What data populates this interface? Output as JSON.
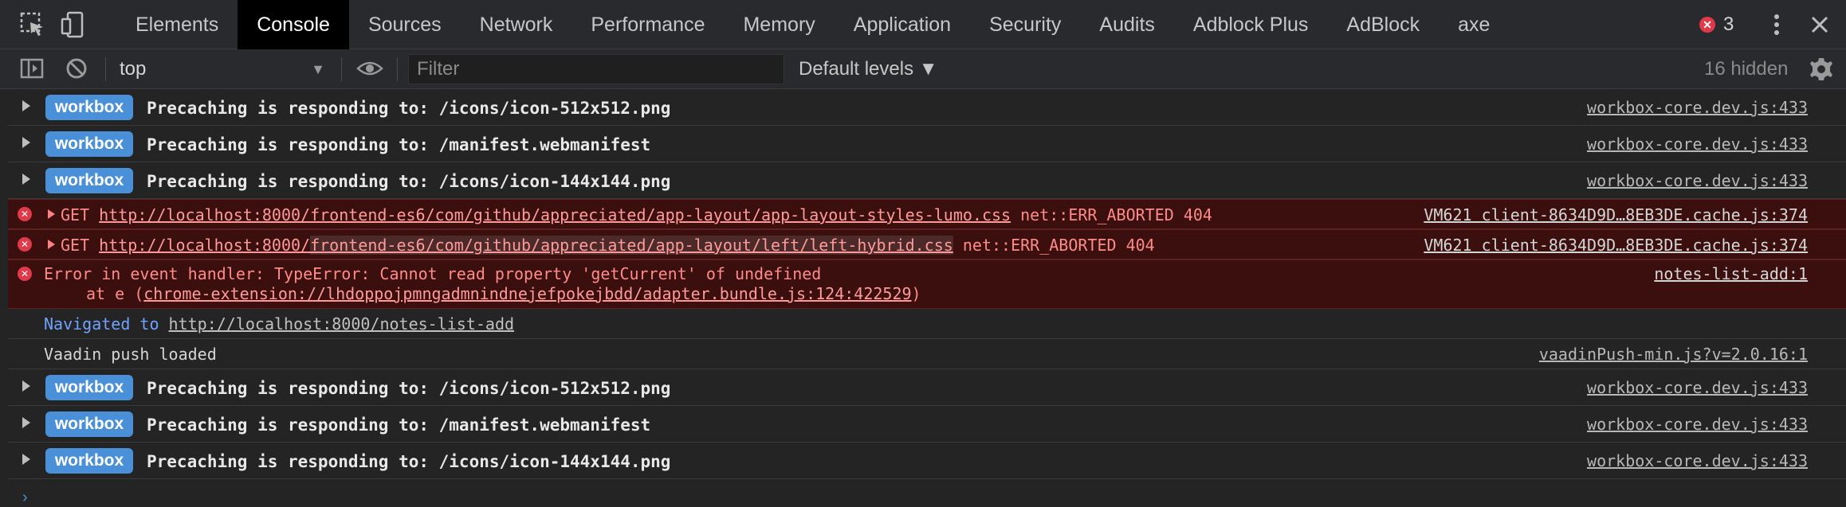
{
  "tabs": [
    "Elements",
    "Console",
    "Sources",
    "Network",
    "Performance",
    "Memory",
    "Application",
    "Security",
    "Audits",
    "Adblock Plus",
    "AdBlock",
    "axe"
  ],
  "active_tab": "Console",
  "error_count": "3",
  "toolbar": {
    "context": "top",
    "filter_placeholder": "Filter",
    "levels": "Default levels ▼",
    "hidden": "16 hidden"
  },
  "rows": {
    "r1": {
      "badge": "workbox",
      "msg": "Precaching is responding to: /icons/icon-512x512.png",
      "src": "workbox-core.dev.js:433"
    },
    "r2": {
      "badge": "workbox",
      "msg": "Precaching is responding to: /manifest.webmanifest",
      "src": "workbox-core.dev.js:433"
    },
    "r3": {
      "badge": "workbox",
      "msg": "Precaching is responding to: /icons/icon-144x144.png",
      "src": "workbox-core.dev.js:433"
    },
    "e1": {
      "method": "GET",
      "url": "http://localhost:8000/frontend-es6/com/github/appreciated/app-layout/app-layout-styles-lumo.css",
      "status": "net::ERR_ABORTED 404",
      "src": "VM621 client-8634D9D…8EB3DE.cache.js:374"
    },
    "e2": {
      "method": "GET",
      "url_host": "http://localhost:8000/",
      "url_path": "frontend-es6/com/github/appreciated/app-layout/left/left-hybrid.css",
      "status": "net::ERR_ABORTED 404",
      "src": "VM621 client-8634D9D…8EB3DE.cache.js:374"
    },
    "e3": {
      "line1": "Error in event handler: TypeError: Cannot read property 'getCurrent' of undefined",
      "line2_prefix": "at e (",
      "line2_link": "chrome-extension://lhdoppojpmngadmnindnejefpokejbdd/adapter.bundle.js:124:422529",
      "line2_suffix": ")",
      "src": "notes-list-add:1"
    },
    "nav": {
      "prefix": "Navigated to ",
      "url": "http://localhost:8000/notes-list-add"
    },
    "vaadin": {
      "msg": "Vaadin push loaded",
      "src": "vaadinPush-min.js?v=2.0.16:1"
    },
    "r4": {
      "badge": "workbox",
      "msg": "Precaching is responding to: /icons/icon-512x512.png",
      "src": "workbox-core.dev.js:433"
    },
    "r5": {
      "badge": "workbox",
      "msg": "Precaching is responding to: /manifest.webmanifest",
      "src": "workbox-core.dev.js:433"
    },
    "r6": {
      "badge": "workbox",
      "msg": "Precaching is responding to: /icons/icon-144x144.png",
      "src": "workbox-core.dev.js:433"
    }
  },
  "prompt": "›"
}
